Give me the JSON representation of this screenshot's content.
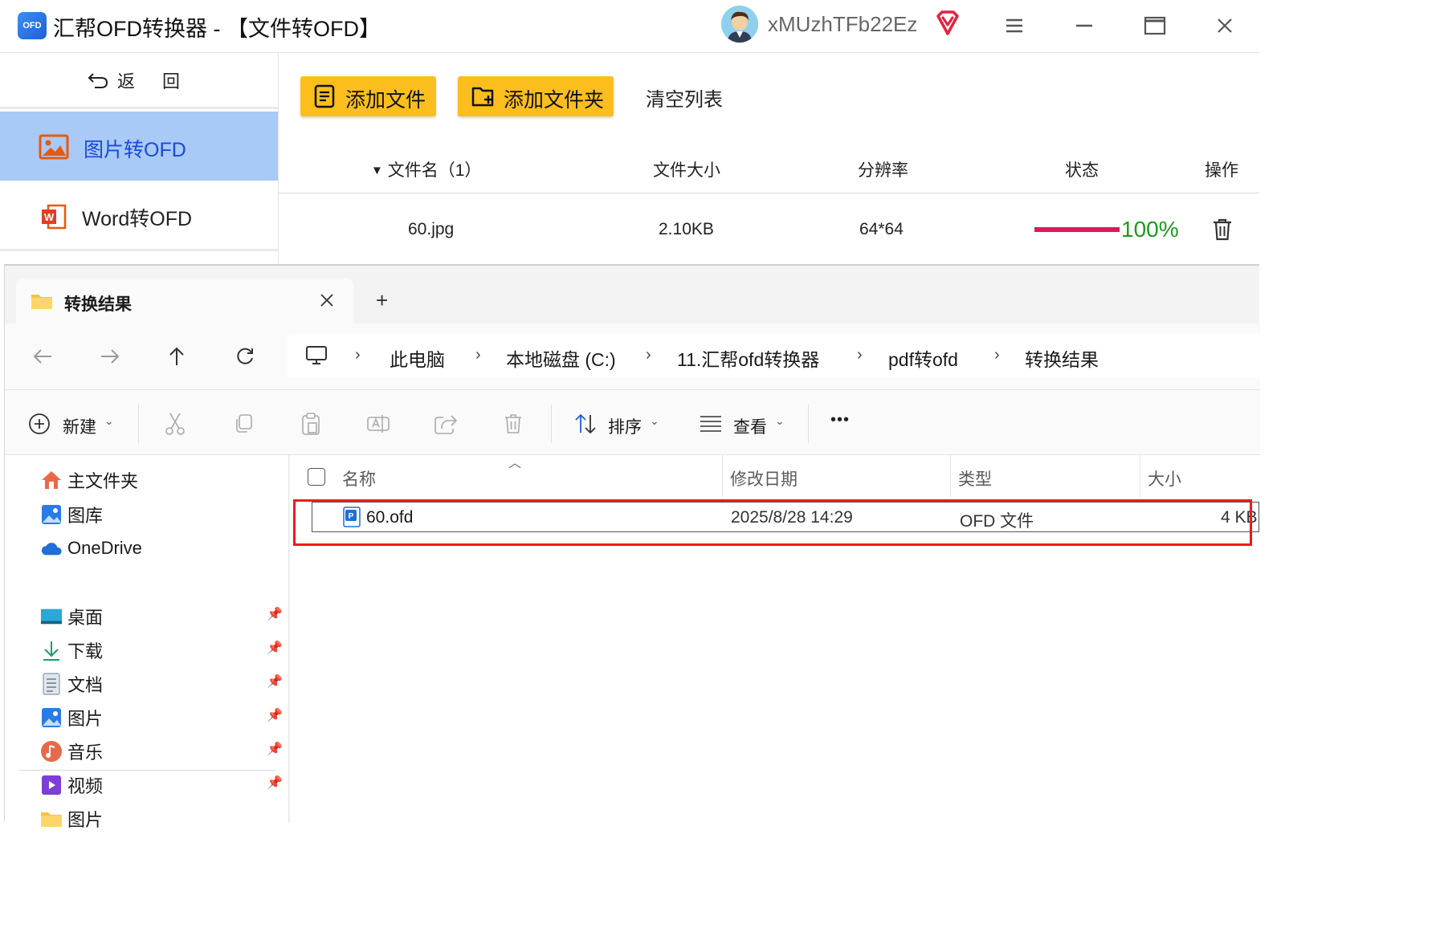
{
  "app": {
    "logo_text": "OFD",
    "title": "汇帮OFD转换器 - 【文件转OFD】",
    "username": "xMUzhTFb22Ez",
    "colors": {
      "accent_yellow": "#fbbe1d",
      "nav_selected": "#a9c9f7",
      "progress": "#e3175c",
      "percent": "#1e9a1e"
    }
  },
  "sidebar": {
    "back_label": "返 回",
    "items": [
      {
        "label": "图片转OFD",
        "icon": "image-icon",
        "selected": true
      },
      {
        "label": "Word转OFD",
        "icon": "word-icon",
        "selected": false
      }
    ]
  },
  "toolbar": {
    "add_file": "添加文件",
    "add_folder": "添加文件夹",
    "clear": "清空列表"
  },
  "table": {
    "headers": [
      "文件名（1）",
      "文件大小",
      "分辨率",
      "状态",
      "操作"
    ],
    "rows": [
      {
        "name": "60.jpg",
        "size": "2.10KB",
        "resolution": "64*64",
        "progress": 100,
        "percent_text": "100%"
      }
    ]
  },
  "explorer": {
    "tab_title": "转换结果",
    "new_tab_symbol": "+",
    "breadcrumb": [
      "此电脑",
      "本地磁盘 (C:)",
      "11.汇帮ofd转换器",
      "pdf转ofd",
      "转换结果"
    ],
    "toolbar": {
      "new_label": "新建",
      "sort_label": "排序",
      "view_label": "查看",
      "more_symbol": "•••"
    },
    "nav": {
      "top": [
        {
          "label": "主文件夹",
          "icon": "home-icon"
        },
        {
          "label": "图库",
          "icon": "gallery-icon"
        },
        {
          "label": "OneDrive",
          "icon": "cloud-icon"
        }
      ],
      "quick": [
        {
          "label": "桌面",
          "icon": "desktop-icon"
        },
        {
          "label": "下载",
          "icon": "download-icon"
        },
        {
          "label": "文档",
          "icon": "document-icon"
        },
        {
          "label": "图片",
          "icon": "pictures-icon"
        },
        {
          "label": "音乐",
          "icon": "music-icon"
        },
        {
          "label": "视频",
          "icon": "video-icon"
        },
        {
          "label": "图片",
          "icon": "folder-icon"
        }
      ]
    },
    "columns": [
      "名称",
      "修改日期",
      "类型",
      "大小"
    ],
    "files": [
      {
        "name": "60.ofd",
        "modified": "2025/8/28 14:29",
        "type": "OFD 文件",
        "size": "4 KB"
      }
    ]
  }
}
